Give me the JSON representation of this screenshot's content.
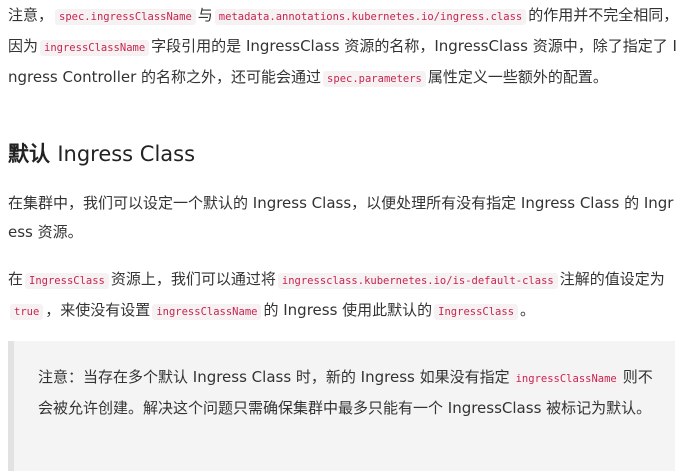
{
  "para1": {
    "t1": "注意，",
    "c1": "spec.ingressClassName",
    "t2": "与",
    "c2": "metadata.annotations.kubernetes.io/ingress.class",
    "t3": "的作用并不完全相同，因为",
    "c3": "ingressClassName",
    "t4": "字段引用的是 IngressClass 资源的名称，IngressClass 资源中，除了指定了 Ingress Controller 的名称之外，还可能会通过",
    "c4": "spec.parameters",
    "t5": "属性定义一些额外的配置。"
  },
  "heading": {
    "bold": "默认",
    "rest": "Ingress Class"
  },
  "para2": {
    "text": "在集群中，我们可以设定一个默认的 Ingress Class，以便处理所有没有指定 Ingress Class 的 Ingress 资源。"
  },
  "para3": {
    "t1": "在",
    "c1": "IngressClass",
    "t2": "资源上，我们可以通过将",
    "c2": "ingressclass.kubernetes.io/is-default-class",
    "t3": "注解的值设定为",
    "c3": "true",
    "t4": "，来使没有设置",
    "c4": "ingressClassName",
    "t5": "的 Ingress 使用此默认的",
    "c5": "IngressClass",
    "t6": "。"
  },
  "note": {
    "t1": "注意：当存在多个默认 Ingress Class 时，新的 Ingress 如果没有指定",
    "c1": "ingressClassName",
    "t2": "则不会被允许创建。解决这个问题只需确保集群中最多只能有一个 IngressClass 被标记为默认。"
  },
  "colors": {
    "text": "#333333",
    "code_text": "#c7254e",
    "code_bg": "#f6f2f4",
    "note_bg": "#f4f4f4",
    "note_border": "#e2e2e2"
  }
}
